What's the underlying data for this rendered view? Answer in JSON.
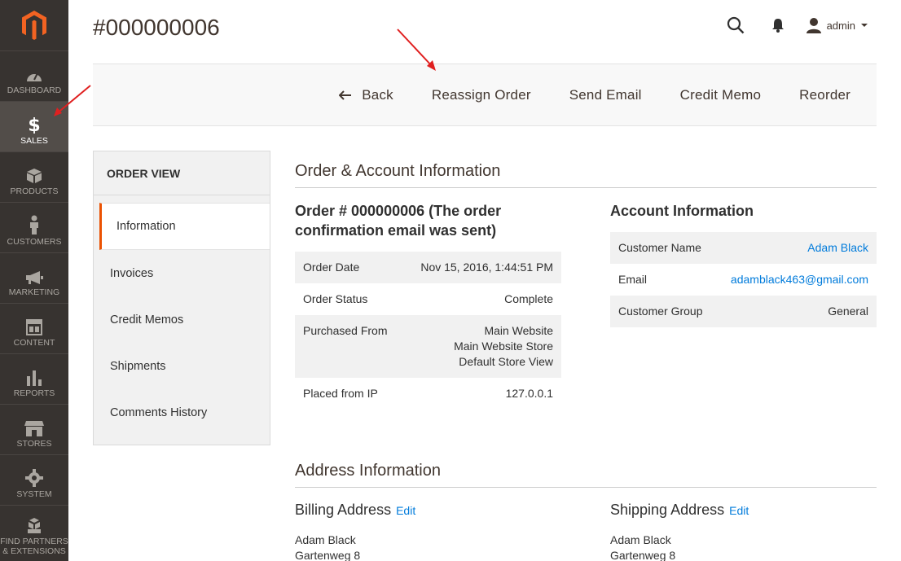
{
  "sidebar": {
    "logo": "magento-logo",
    "items": [
      {
        "label": "DASHBOARD",
        "icon": "dashboard-icon"
      },
      {
        "label": "SALES",
        "icon": "dollar-icon",
        "active": true
      },
      {
        "label": "PRODUCTS",
        "icon": "box-icon"
      },
      {
        "label": "CUSTOMERS",
        "icon": "person-icon"
      },
      {
        "label": "MARKETING",
        "icon": "megaphone-icon"
      },
      {
        "label": "CONTENT",
        "icon": "layout-icon"
      },
      {
        "label": "REPORTS",
        "icon": "bar-chart-icon"
      },
      {
        "label": "STORES",
        "icon": "storefront-icon"
      },
      {
        "label": "SYSTEM",
        "icon": "gear-icon"
      },
      {
        "label": "FIND PARTNERS & EXTENSIONS",
        "line1": "FIND PARTNERS",
        "line2": "& EXTENSIONS",
        "icon": "blocks-icon"
      }
    ]
  },
  "header": {
    "title": "#000000006",
    "user": "admin"
  },
  "toolbar": {
    "back": "Back",
    "reassign": "Reassign Order",
    "send_email": "Send Email",
    "credit_memo": "Credit Memo",
    "reorder": "Reorder"
  },
  "tabs": {
    "title": "ORDER VIEW",
    "items": [
      "Information",
      "Invoices",
      "Credit Memos",
      "Shipments",
      "Comments History"
    ]
  },
  "order_account": {
    "section_title": "Order & Account Information",
    "order_heading_line1": "Order # 000000006 (The order",
    "order_heading_line2": "confirmation email was sent)",
    "order_rows": {
      "date_label": "Order Date",
      "date_value": "Nov 15, 2016, 1:44:51 PM",
      "status_label": "Order Status",
      "status_value": "Complete",
      "purchased_label": "Purchased From",
      "purchased_line1": "Main Website",
      "purchased_line2": "Main Website Store",
      "purchased_line3": "Default Store View",
      "ip_label": "Placed from IP",
      "ip_value": "127.0.0.1"
    },
    "account_heading": "Account Information",
    "account_rows": {
      "name_label": "Customer Name",
      "name_value": "Adam Black",
      "email_label": "Email",
      "email_value": "adamblack463@gmail.com",
      "group_label": "Customer Group",
      "group_value": "General"
    }
  },
  "address": {
    "section_title": "Address Information",
    "billing_heading": "Billing Address",
    "shipping_heading": "Shipping Address",
    "edit_label": "Edit",
    "billing_lines": [
      "Adam Black",
      "Gartenweg 8"
    ],
    "shipping_lines": [
      "Adam Black",
      "Gartenweg 8"
    ]
  },
  "colors": {
    "sidebar_bg": "#373330",
    "active_tab_accent": "#eb5202",
    "link": "#007bdb",
    "annotation_arrow": "#e02020"
  }
}
